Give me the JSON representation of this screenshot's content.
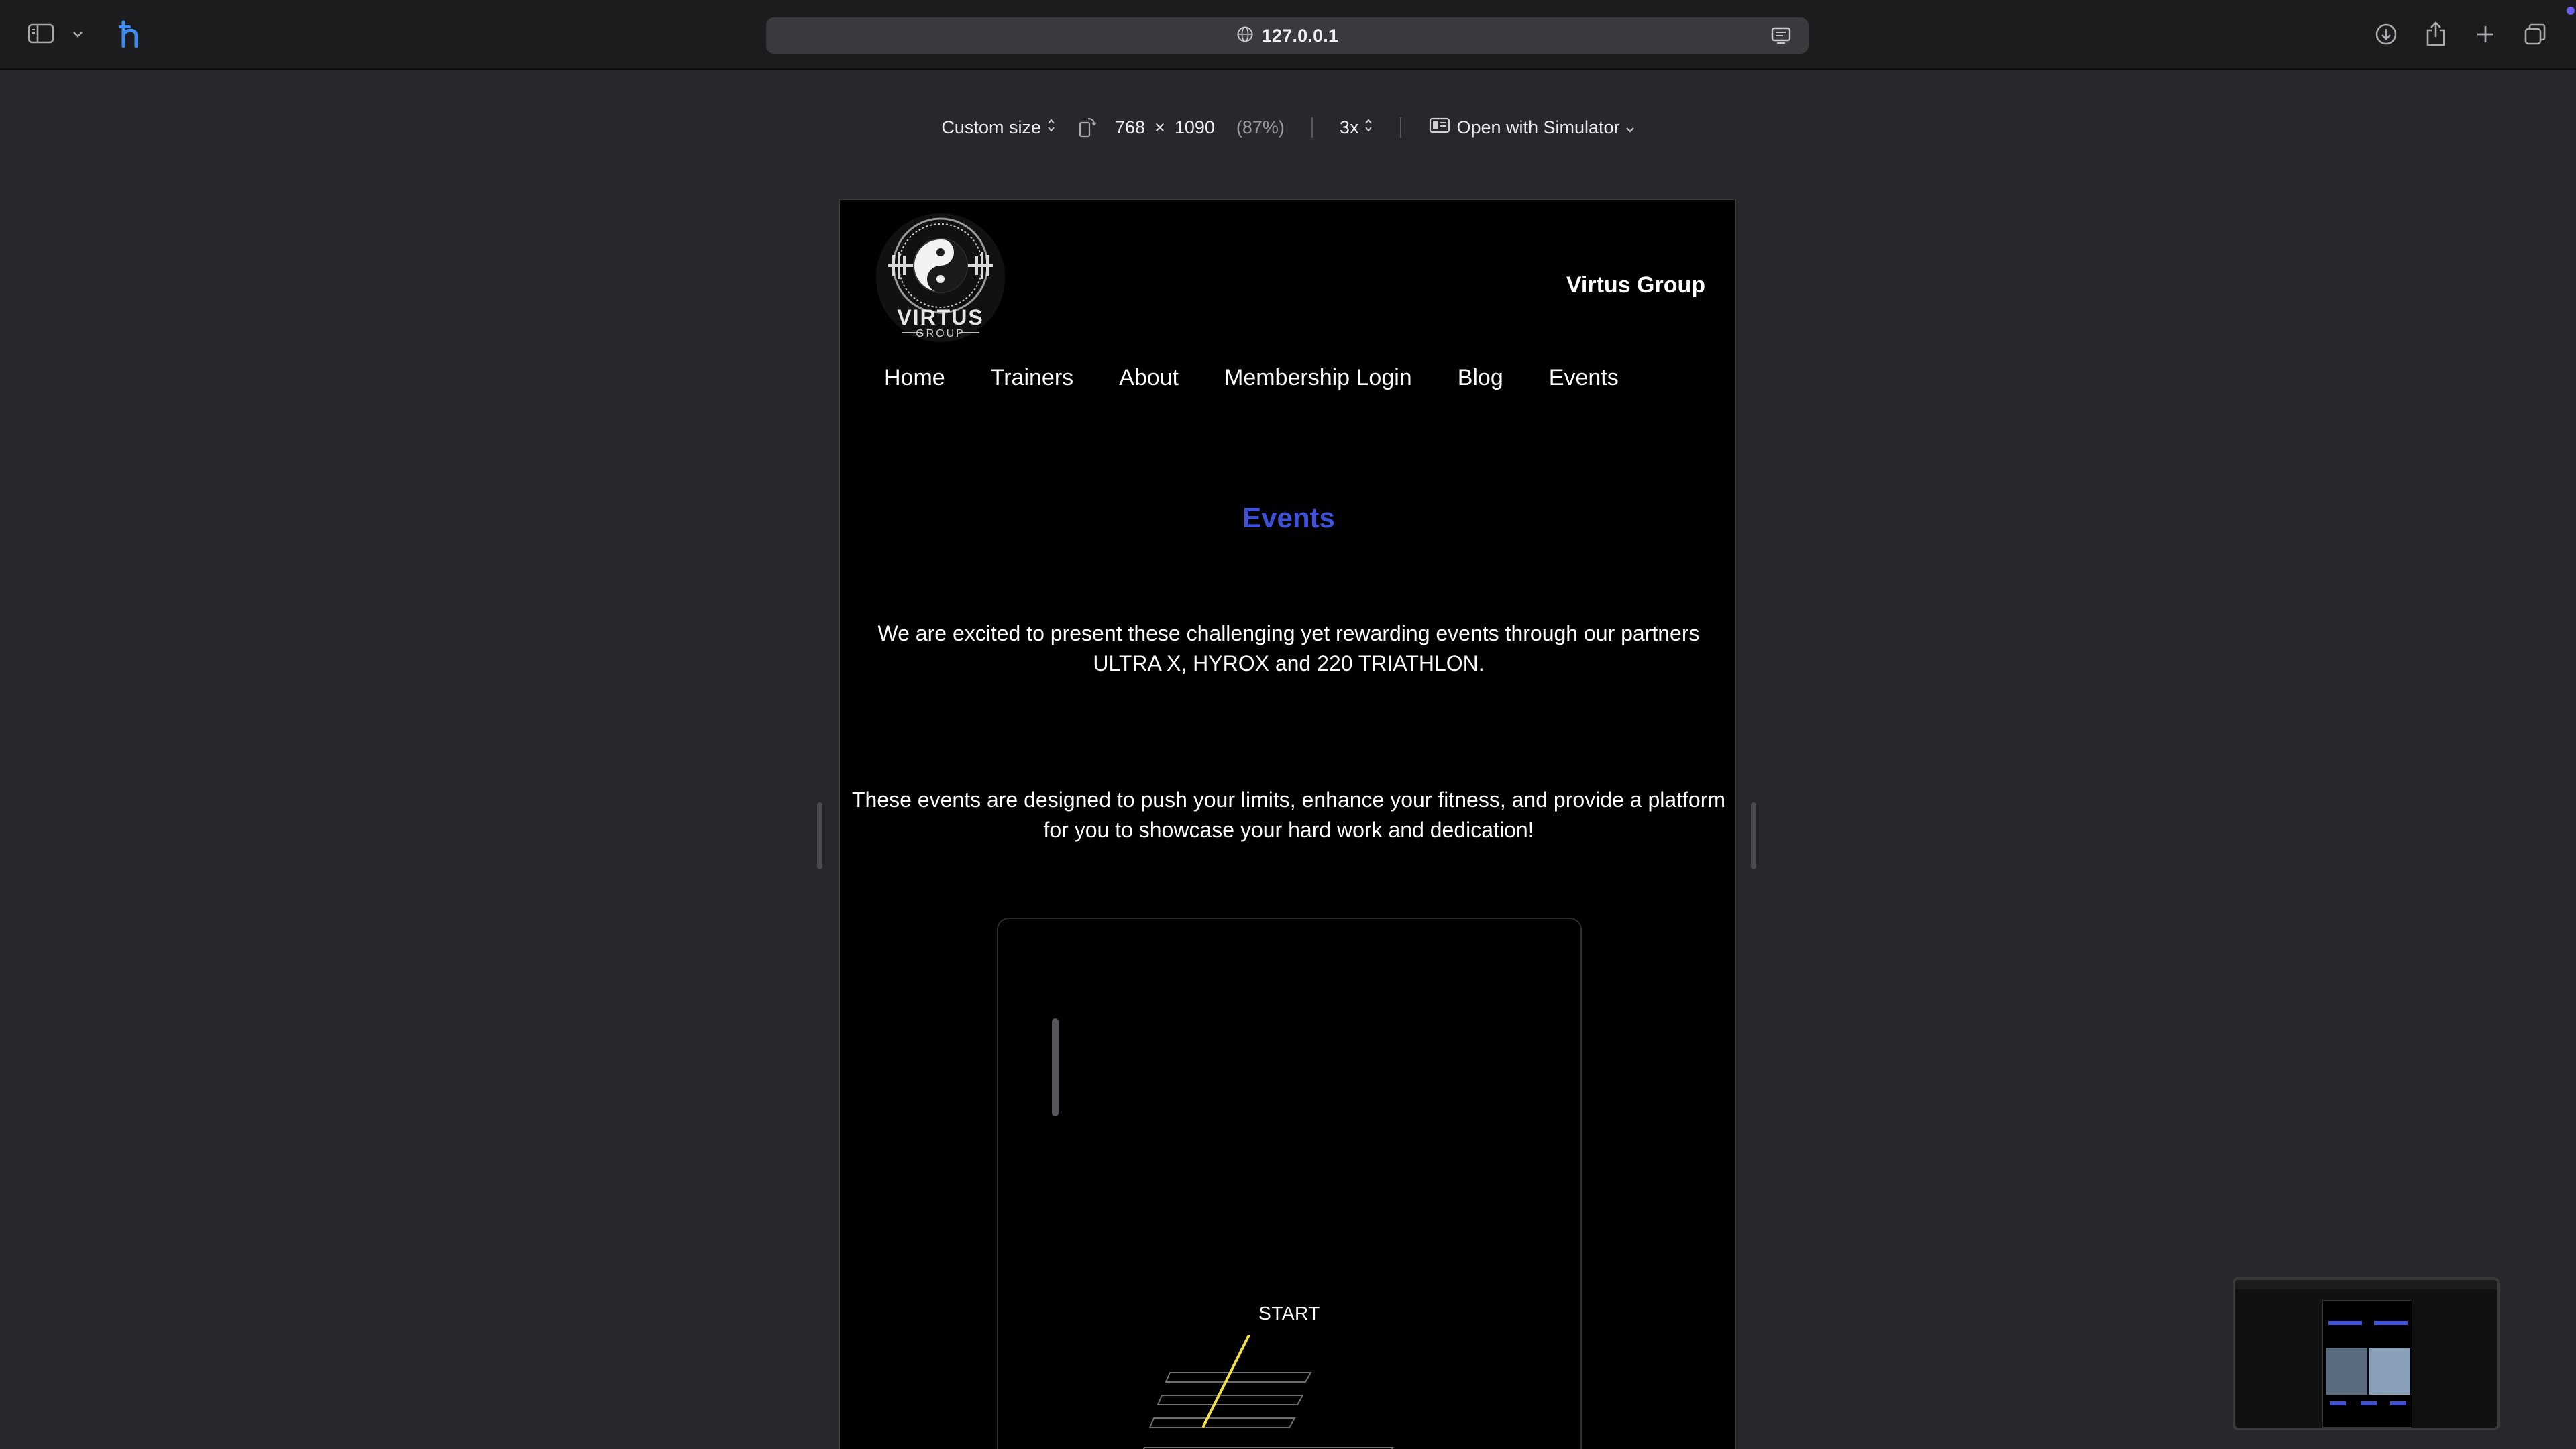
{
  "browser": {
    "url": "127.0.0.1",
    "icons": {
      "sidebar": "sidebar-icon",
      "chevron": "chevron-down-icon",
      "extension": "h-extension-icon",
      "globe": "globe-icon",
      "reader": "reader-mode-icon",
      "download": "download-icon",
      "share": "share-icon",
      "new_tab": "plus-icon",
      "tabs": "tab-overview-icon"
    }
  },
  "responsive_bar": {
    "size_preset": "Custom size",
    "width": "768",
    "times": "×",
    "height": "1090",
    "zoom": "(87%)",
    "scale": "3x",
    "simulator": "Open with Simulator"
  },
  "site": {
    "brand": "Virtus Group",
    "logo_text": "VIRTUS",
    "logo_subtext": "GROUP",
    "nav": [
      "Home",
      "Trainers",
      "About",
      "Membership Login",
      "Blog",
      "Events"
    ],
    "page_title": "Events",
    "paragraph_1": "We are excited to present these challenging yet rewarding events through our partners ULTRA X, HYROX and 220 TRIATHLON.",
    "paragraph_2": "These events are designed to push your limits, enhance your fitness, and provide a platform for you to showcase your hard work and dedication!",
    "card": {
      "start_label": "START"
    }
  },
  "colors": {
    "accent_title": "#3f51d9",
    "track_line": "#f2e04a",
    "page_bg": "#000000",
    "chrome_bg": "#28282c"
  }
}
